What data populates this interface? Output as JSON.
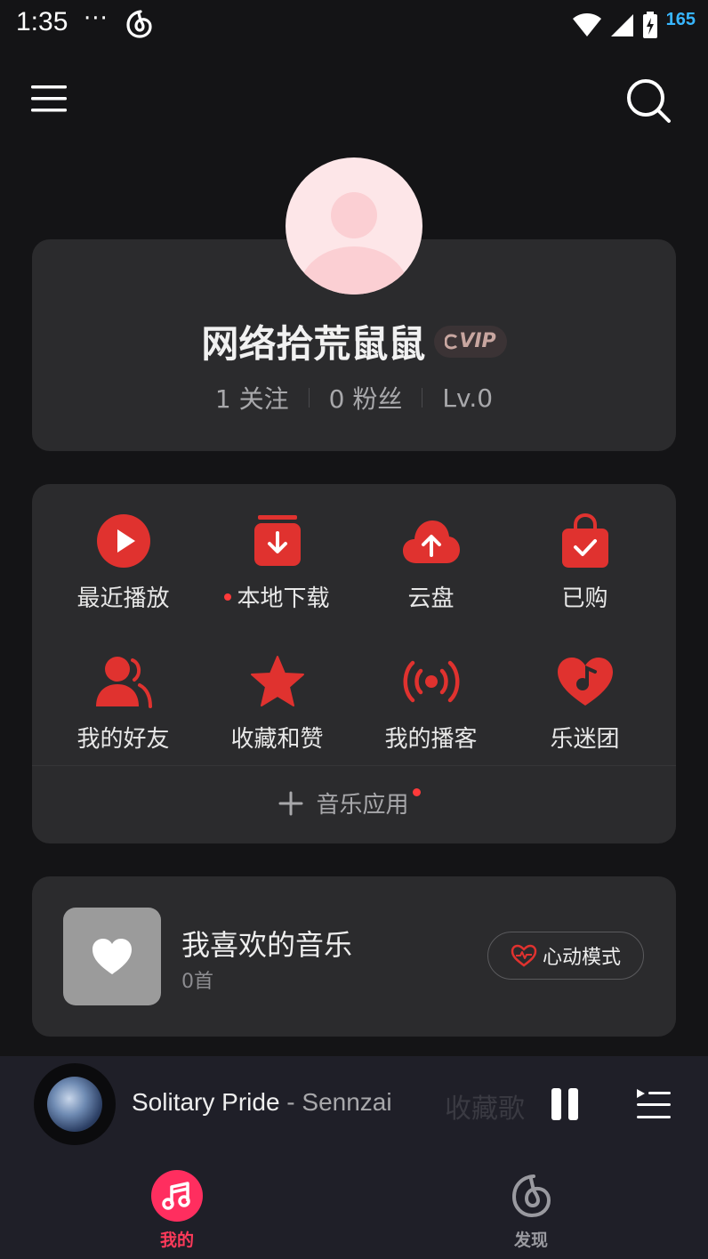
{
  "status_bar": {
    "time": "1:35",
    "dots": "···",
    "battery_level": "165"
  },
  "profile": {
    "username": "网络拾荒鼠鼠",
    "vip_badge": "VIP",
    "following": "1 关注",
    "followers": "0 粉丝",
    "level": "Lv.0"
  },
  "grid": {
    "items": [
      {
        "label": "最近播放",
        "icon": "play-circle-icon"
      },
      {
        "label": "本地下载",
        "icon": "download-box-icon"
      },
      {
        "label": "云盘",
        "icon": "cloud-upload-icon"
      },
      {
        "label": "已购",
        "icon": "shopping-bag-icon"
      },
      {
        "label": "我的好友",
        "icon": "friends-icon"
      },
      {
        "label": "收藏和赞",
        "icon": "star-icon"
      },
      {
        "label": "我的播客",
        "icon": "broadcast-icon"
      },
      {
        "label": "乐迷团",
        "icon": "heart-note-icon"
      }
    ],
    "music_apps_label": "音乐应用"
  },
  "liked": {
    "title": "我喜欢的音乐",
    "count": "0首",
    "heartbeat_label": "心动模式"
  },
  "player": {
    "track_title": "Solitary Pride",
    "artist": " - Sennzai",
    "ghost_text": "收藏歌"
  },
  "tabs": {
    "mine": "我的",
    "discover": "发现"
  },
  "colors": {
    "accent_red": "#e0322f",
    "tab_active": "#ff2e5f",
    "card_bg": "#2b2b2d",
    "bg": "#141416"
  }
}
